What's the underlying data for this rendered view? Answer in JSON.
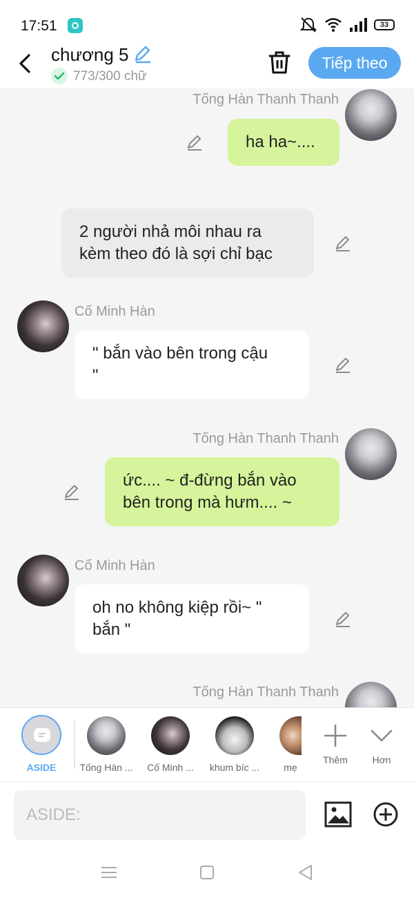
{
  "status_bar": {
    "time": "17:51",
    "battery": "33",
    "icons": [
      "app-notification-icon",
      "mute-icon",
      "wifi-icon",
      "signal-icon",
      "battery-icon"
    ]
  },
  "header": {
    "title": "chương 5",
    "word_count": "773/300 chữ",
    "next_button": "Tiếp theo",
    "accent_color": "#5aa9f0"
  },
  "messages": [
    {
      "speaker": "Tống Hàn Thanh Thanh",
      "side": "right",
      "text_lines": [
        "ha ha~...."
      ]
    },
    {
      "speaker": "",
      "side": "aside",
      "text_lines": [
        "2 người nhả môi nhau ra",
        "kèm theo đó là sợi chỉ bạc"
      ]
    },
    {
      "speaker": "Cố Minh Hàn",
      "side": "left",
      "text_lines": [
        "\" bắn vào bên trong cậu",
        "\""
      ]
    },
    {
      "speaker": "Tống Hàn Thanh Thanh",
      "side": "right",
      "text_lines": [
        "ức.... ~ đ-đừng bắn vào",
        "bên trong mà hưm.... ~"
      ]
    },
    {
      "speaker": "Cố Minh Hàn",
      "side": "left",
      "text_lines": [
        "oh no không kiệp rồi~ \"",
        "bắn \""
      ]
    },
    {
      "speaker": "Tống Hàn Thanh Thanh",
      "side": "right",
      "text_lines": []
    }
  ],
  "character_bar": {
    "aside_label": "ASIDE",
    "characters": [
      {
        "label": "Tống Hàn ..."
      },
      {
        "label": "Cố Minh ..."
      },
      {
        "label": "khum bíc ..."
      },
      {
        "label": "mẹ"
      }
    ],
    "add_label": "Thêm",
    "more_label": "Hơn"
  },
  "input": {
    "placeholder": "ASIDE:"
  },
  "colors": {
    "green_bubble": "#d6f49b",
    "aside_bubble": "#ebebeb",
    "white_bubble": "#ffffff"
  }
}
